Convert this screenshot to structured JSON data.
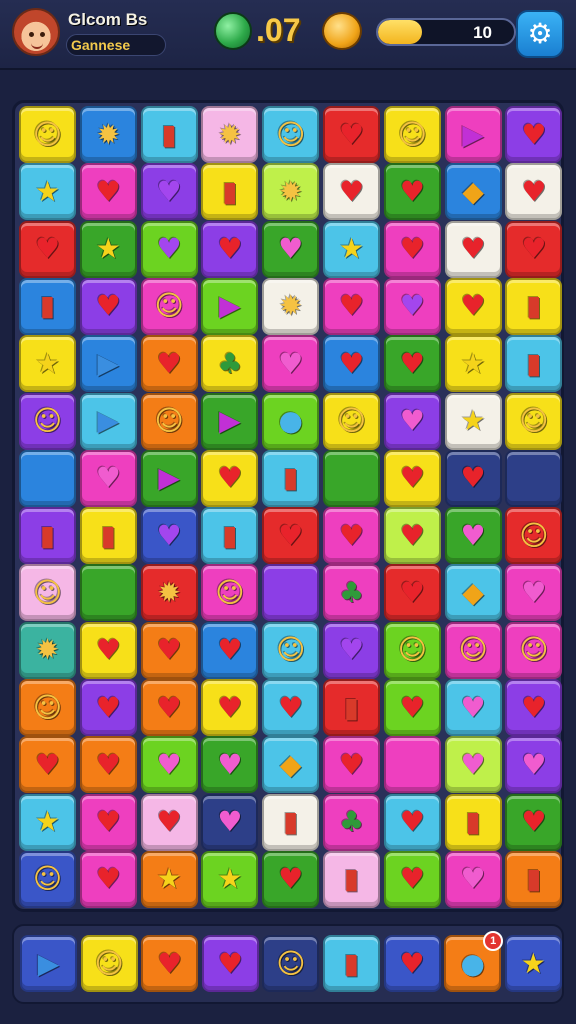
{
  "header": {
    "player_name": "Glcom Bs",
    "player_subtitle": "Gannese",
    "score": ".07",
    "progress_value": "10",
    "progress_fraction": 0.32,
    "avatar_icon": "player-avatar-icon",
    "gem_icon": "green-gem-icon",
    "coin_icon": "gold-coin-icon",
    "settings_icon": "settings-gear-icon"
  },
  "palette": {
    "Y": "#f7e019",
    "O": "#f47d16",
    "R": "#e52b2b",
    "P": "#ee3fbf",
    "V": "#8c3ee6",
    "B": "#2b84de",
    "C": "#4cc4e8",
    "G": "#6cd321",
    "D": "#39a629",
    "W": "#f4f1e8",
    "K": "#f5b7e6",
    "M": "#2d3f88",
    "L": "#bff04a",
    "E": "#3bb3a0",
    "S": "#3a56c8"
  },
  "icon_colors": {
    "face": "#f5c242",
    "sun": "#f5c242",
    "star": "#f5d31b",
    "heart": "#e8232b",
    "heart-pink": "#f05ccf",
    "heart-purple": "#a346ee",
    "triangle": "#c130d6",
    "arrow": "#3a8ee0",
    "diamond": "#f0a418",
    "block": "#d83a2a",
    "drop": "#48b4e8",
    "leaf": "#2f9a3a",
    "none": "#ffffff"
  },
  "icon_glyphs": {
    "face": "☺",
    "sun": "✹",
    "star": "★",
    "heart": "♥",
    "heart-pink": "♥",
    "heart-purple": "♥",
    "triangle": "▶",
    "arrow": "▶",
    "diamond": "◆",
    "block": "▮",
    "drop": "●",
    "leaf": "♣",
    "none": ""
  },
  "board": {
    "rows": 14,
    "cols": 9,
    "cells": [
      [
        [
          "Y",
          "face"
        ],
        [
          "B",
          "sun"
        ],
        [
          "C",
          "block"
        ],
        [
          "K",
          "sun"
        ],
        [
          "C",
          "face"
        ],
        [
          "R",
          "heart"
        ],
        [
          "Y",
          "face"
        ],
        [
          "P",
          "triangle"
        ],
        [
          "V",
          "heart"
        ]
      ],
      [
        [
          "C",
          "star"
        ],
        [
          "P",
          "heart"
        ],
        [
          "V",
          "heart-purple"
        ],
        [
          "Y",
          "block"
        ],
        [
          "L",
          "sun"
        ],
        [
          "W",
          "heart"
        ],
        [
          "D",
          "heart"
        ],
        [
          "B",
          "diamond"
        ],
        [
          "W",
          "heart"
        ]
      ],
      [
        [
          "R",
          "heart"
        ],
        [
          "D",
          "star"
        ],
        [
          "G",
          "heart-purple"
        ],
        [
          "V",
          "heart"
        ],
        [
          "D",
          "heart-pink"
        ],
        [
          "C",
          "star"
        ],
        [
          "P",
          "heart"
        ],
        [
          "W",
          "heart"
        ],
        [
          "R",
          "heart"
        ]
      ],
      [
        [
          "B",
          "block"
        ],
        [
          "V",
          "heart"
        ],
        [
          "P",
          "face"
        ],
        [
          "G",
          "triangle"
        ],
        [
          "W",
          "sun"
        ],
        [
          "P",
          "heart"
        ],
        [
          "P",
          "heart-purple"
        ],
        [
          "Y",
          "heart"
        ],
        [
          "Y",
          "block"
        ]
      ],
      [
        [
          "Y",
          "star"
        ],
        [
          "B",
          "arrow"
        ],
        [
          "O",
          "heart"
        ],
        [
          "Y",
          "leaf"
        ],
        [
          "P",
          "heart-pink"
        ],
        [
          "B",
          "heart"
        ],
        [
          "D",
          "heart"
        ],
        [
          "Y",
          "star"
        ],
        [
          "C",
          "block"
        ]
      ],
      [
        [
          "V",
          "face"
        ],
        [
          "C",
          "arrow"
        ],
        [
          "O",
          "face"
        ],
        [
          "D",
          "triangle"
        ],
        [
          "G",
          "drop"
        ],
        [
          "Y",
          "face"
        ],
        [
          "V",
          "heart-pink"
        ],
        [
          "W",
          "star"
        ],
        [
          "Y",
          "face"
        ]
      ],
      [
        [
          "B",
          "none"
        ],
        [
          "P",
          "heart-pink"
        ],
        [
          "D",
          "triangle"
        ],
        [
          "Y",
          "heart"
        ],
        [
          "C",
          "block"
        ],
        [
          "D",
          "none"
        ],
        [
          "Y",
          "heart"
        ],
        [
          "M",
          "heart"
        ],
        [
          "M",
          "none"
        ]
      ],
      [
        [
          "V",
          "block"
        ],
        [
          "Y",
          "block"
        ],
        [
          "S",
          "heart-purple"
        ],
        [
          "C",
          "block"
        ],
        [
          "R",
          "heart"
        ],
        [
          "P",
          "heart"
        ],
        [
          "L",
          "heart"
        ],
        [
          "D",
          "heart-pink"
        ],
        [
          "R",
          "face"
        ]
      ],
      [
        [
          "K",
          "face"
        ],
        [
          "D",
          "none"
        ],
        [
          "R",
          "sun"
        ],
        [
          "P",
          "face"
        ],
        [
          "V",
          "none"
        ],
        [
          "P",
          "leaf"
        ],
        [
          "R",
          "heart"
        ],
        [
          "C",
          "diamond"
        ],
        [
          "P",
          "heart-pink"
        ]
      ],
      [
        [
          "E",
          "sun"
        ],
        [
          "Y",
          "heart"
        ],
        [
          "O",
          "heart"
        ],
        [
          "B",
          "heart"
        ],
        [
          "C",
          "face"
        ],
        [
          "V",
          "heart-purple"
        ],
        [
          "G",
          "face"
        ],
        [
          "P",
          "face"
        ],
        [
          "P",
          "face"
        ]
      ],
      [
        [
          "O",
          "face"
        ],
        [
          "V",
          "heart"
        ],
        [
          "O",
          "heart"
        ],
        [
          "Y",
          "heart"
        ],
        [
          "C",
          "heart"
        ],
        [
          "R",
          "block"
        ],
        [
          "G",
          "heart"
        ],
        [
          "C",
          "heart-pink"
        ],
        [
          "V",
          "heart"
        ]
      ],
      [
        [
          "O",
          "heart"
        ],
        [
          "O",
          "heart"
        ],
        [
          "G",
          "heart-pink"
        ],
        [
          "D",
          "heart-pink"
        ],
        [
          "C",
          "diamond"
        ],
        [
          "P",
          "heart"
        ],
        [
          "P",
          "none"
        ],
        [
          "L",
          "heart-pink"
        ],
        [
          "V",
          "heart-pink"
        ]
      ],
      [
        [
          "C",
          "star"
        ],
        [
          "P",
          "heart"
        ],
        [
          "K",
          "heart"
        ],
        [
          "M",
          "heart-pink"
        ],
        [
          "W",
          "block"
        ],
        [
          "P",
          "leaf"
        ],
        [
          "C",
          "heart"
        ],
        [
          "Y",
          "block"
        ],
        [
          "D",
          "heart"
        ]
      ],
      [
        [
          "S",
          "face"
        ],
        [
          "P",
          "heart"
        ],
        [
          "O",
          "star"
        ],
        [
          "G",
          "star"
        ],
        [
          "D",
          "heart"
        ],
        [
          "K",
          "block"
        ],
        [
          "G",
          "heart"
        ],
        [
          "P",
          "heart-pink"
        ],
        [
          "O",
          "block"
        ]
      ]
    ]
  },
  "tray": {
    "items": [
      {
        "bg": "S",
        "icon": "arrow",
        "name": "tray-arrow-tile"
      },
      {
        "bg": "Y",
        "icon": "face",
        "name": "tray-face-tile"
      },
      {
        "bg": "O",
        "icon": "heart",
        "name": "tray-heart-tile"
      },
      {
        "bg": "V",
        "icon": "heart",
        "name": "tray-heart-tile"
      },
      {
        "bg": "M",
        "icon": "face",
        "name": "tray-face-tile"
      },
      {
        "bg": "C",
        "icon": "block",
        "name": "tray-block-tile"
      },
      {
        "bg": "S",
        "icon": "heart",
        "name": "tray-heart-tile"
      },
      {
        "bg": "O",
        "icon": "drop",
        "name": "tray-drop-tile"
      },
      {
        "bg": "S",
        "icon": "star",
        "name": "tray-star-tile"
      }
    ],
    "badge_count": "1"
  }
}
